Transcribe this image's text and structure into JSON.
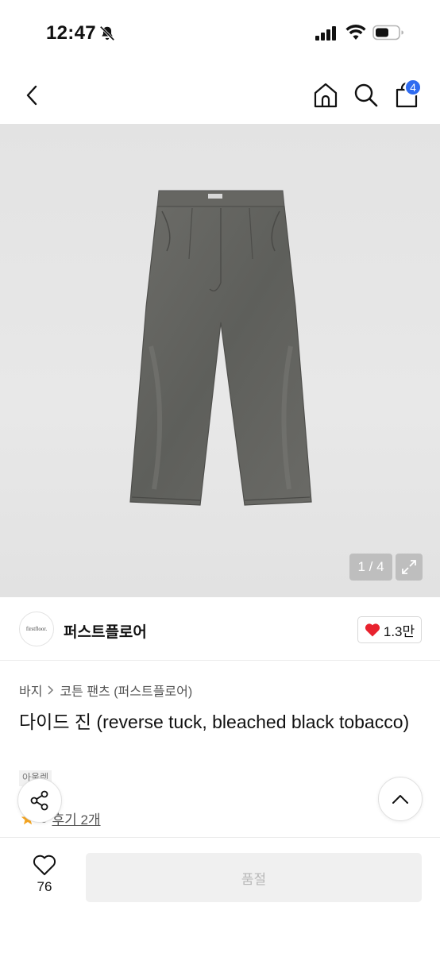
{
  "status_bar": {
    "time": "12:47",
    "icons": [
      "bell-off-icon",
      "signal-icon",
      "wifi-icon",
      "battery-icon"
    ]
  },
  "nav": {
    "icons": [
      "chevron-left-icon",
      "home-icon",
      "search-icon",
      "shopping-bag-icon"
    ],
    "cart_count": "4",
    "accent_color": "#2f6bf0"
  },
  "gallery": {
    "page_indicator": "1 / 4",
    "image": "grey-jeans-image"
  },
  "brand": {
    "logo_text": "firstfloor.",
    "name": "퍼스트플로어",
    "like_count": "1.3만",
    "heart_color": "#e8222e"
  },
  "product": {
    "breadcrumb": [
      "바지",
      "코튼 팬츠 (퍼스트플로어)"
    ],
    "title": "다이드 진 (reverse tuck, bleached black tobacco)",
    "tag": "아울렛",
    "rating": "5",
    "review_label": "후기 2개"
  },
  "bottom_bar": {
    "wish_count": "76",
    "cta_label": "품절"
  }
}
